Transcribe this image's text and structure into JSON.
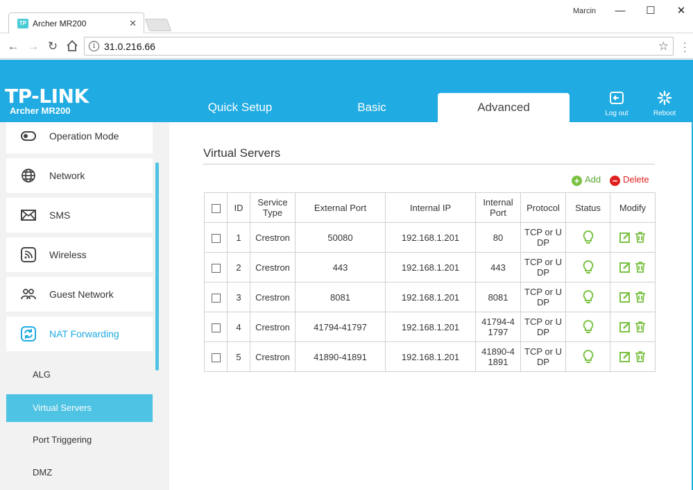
{
  "browser": {
    "tab_title": "Archer MR200",
    "tab_favicon_text": "TP",
    "user": "Marcin",
    "url": "31.0.216.66"
  },
  "header": {
    "logo": "TP-LINK",
    "model": "Archer MR200",
    "tabs": [
      {
        "label": "Quick Setup"
      },
      {
        "label": "Basic"
      },
      {
        "label": "Advanced",
        "active": true
      }
    ],
    "logout_label": "Log out",
    "reboot_label": "Reboot",
    "brand_color": "#20abe2"
  },
  "sidebar": {
    "items": [
      {
        "label": "Operation Mode",
        "icon": "operation-mode-icon"
      },
      {
        "label": "Network",
        "icon": "globe-icon"
      },
      {
        "label": "SMS",
        "icon": "envelope-icon"
      },
      {
        "label": "Wireless",
        "icon": "wireless-icon"
      },
      {
        "label": "Guest Network",
        "icon": "guest-icon"
      },
      {
        "label": "NAT Forwarding",
        "icon": "nat-icon",
        "active": true
      }
    ],
    "subitems": [
      {
        "label": "ALG"
      },
      {
        "label": "Virtual Servers",
        "active": true
      },
      {
        "label": "Port Triggering"
      },
      {
        "label": "DMZ"
      }
    ]
  },
  "main": {
    "title": "Virtual Servers",
    "add_label": "Add",
    "delete_label": "Delete",
    "columns": [
      "ID",
      "Service Type",
      "External Port",
      "Internal IP",
      "Internal Port",
      "Protocol",
      "Status",
      "Modify"
    ],
    "rows": [
      {
        "id": "1",
        "service": "Crestron",
        "ext_port": "50080",
        "int_ip": "192.168.1.201",
        "int_port": "80",
        "protocol": "TCP or UDP"
      },
      {
        "id": "2",
        "service": "Crestron",
        "ext_port": "443",
        "int_ip": "192.168.1.201",
        "int_port": "443",
        "protocol": "TCP or UDP"
      },
      {
        "id": "3",
        "service": "Crestron",
        "ext_port": "8081",
        "int_ip": "192.168.1.201",
        "int_port": "8081",
        "protocol": "TCP or UDP"
      },
      {
        "id": "4",
        "service": "Crestron",
        "ext_port": "41794-41797",
        "int_ip": "192.168.1.201",
        "int_port": "41794-41797",
        "protocol": "TCP or UDP"
      },
      {
        "id": "5",
        "service": "Crestron",
        "ext_port": "41890-41891",
        "int_ip": "192.168.1.201",
        "int_port": "41890-41891",
        "protocol": "TCP or UDP"
      }
    ]
  }
}
